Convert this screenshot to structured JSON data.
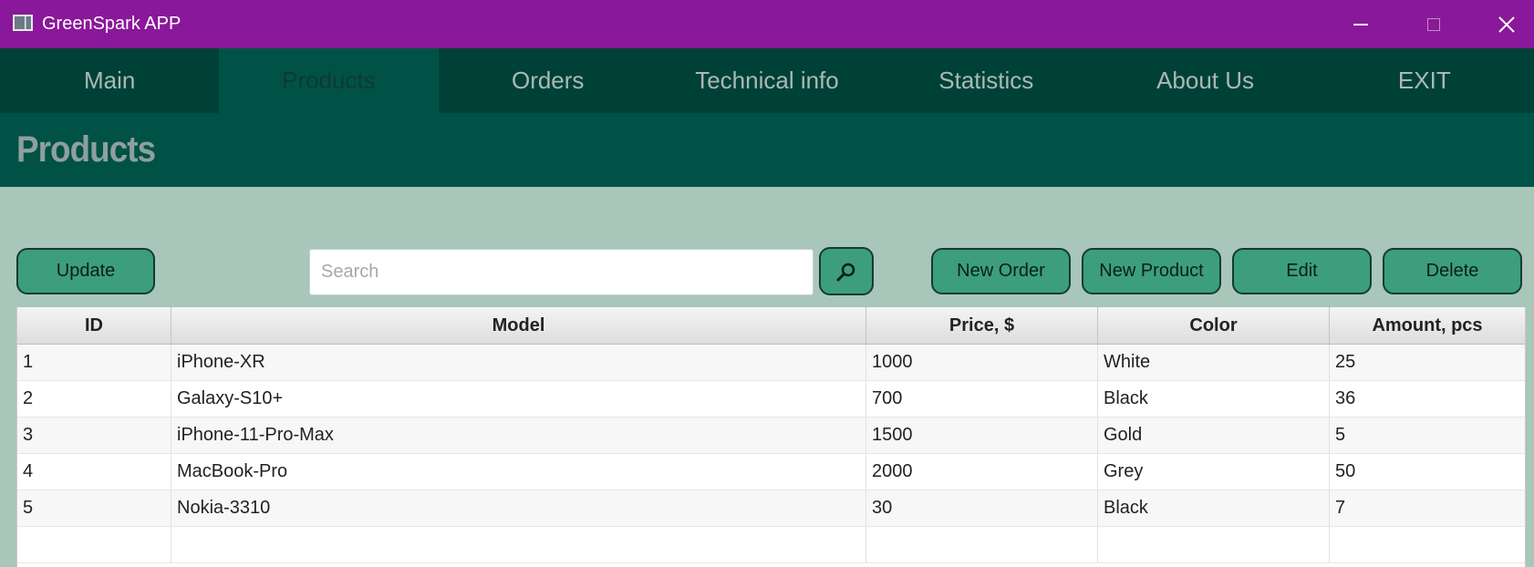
{
  "window": {
    "title": "GreenSpark APP"
  },
  "nav": {
    "tabs": [
      {
        "label": "Main"
      },
      {
        "label": "Products"
      },
      {
        "label": "Orders"
      },
      {
        "label": "Technical info"
      },
      {
        "label": "Statistics"
      },
      {
        "label": "About Us"
      },
      {
        "label": "EXIT"
      }
    ],
    "active_tab": "Products"
  },
  "header": {
    "title": "Products"
  },
  "toolbar": {
    "update_label": "Update",
    "search_placeholder": "Search",
    "search_value": "",
    "new_order_label": "New Order",
    "new_product_label": "New Product",
    "edit_label": "Edit",
    "delete_label": "Delete"
  },
  "table": {
    "columns": [
      "ID",
      "Model",
      "Price, $",
      "Color",
      "Amount, pcs"
    ],
    "rows": [
      [
        "1",
        "iPhone-XR",
        "1000",
        "White",
        "25"
      ],
      [
        "2",
        "Galaxy-S10+",
        "700",
        "Black",
        "36"
      ],
      [
        "3",
        "iPhone-11-Pro-Max",
        "1500",
        "Gold",
        "5"
      ],
      [
        "4",
        "MacBook-Pro",
        "2000",
        "Grey",
        "50"
      ],
      [
        "5",
        "Nokia-3310",
        "30",
        "Black",
        "7"
      ],
      [
        "",
        "",
        "",
        "",
        ""
      ]
    ]
  },
  "colors": {
    "titlebar": "#8a189a",
    "nav_bg": "#004137",
    "header_bg": "#005246",
    "content_bg": "#a9c6ba",
    "button_bg": "#3c9e7c"
  },
  "icons": {
    "app": "app-window-icon",
    "search": "magnifier-icon",
    "minimize": "minimize-icon",
    "maximize": "maximize-icon",
    "close": "close-icon"
  }
}
